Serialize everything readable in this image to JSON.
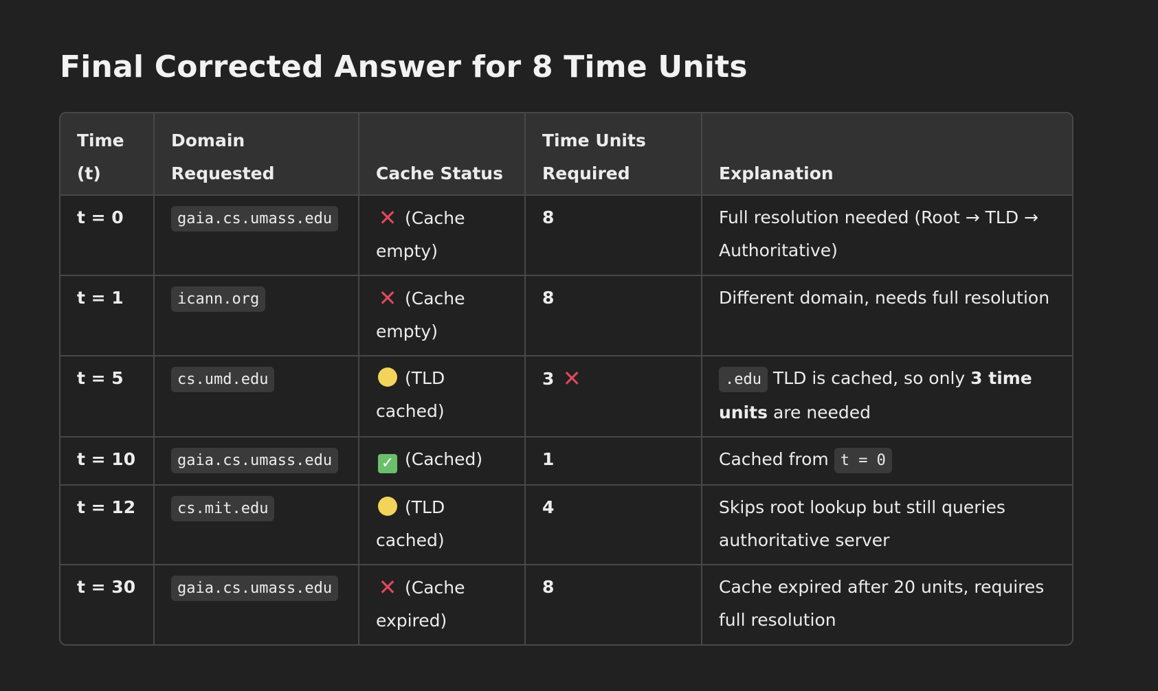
{
  "title": "Final Corrected Answer for 8 Time Units",
  "table": {
    "headers": {
      "time_line1": "Time",
      "time_line2": "(t)",
      "domain": "Domain Requested",
      "cache": "Cache Status",
      "units_line1": "Time Units",
      "units_line2": "Required",
      "explanation": "Explanation"
    },
    "rows": [
      {
        "time": "t = 0",
        "domain": "gaia.cs.umass.edu",
        "cache_icon": "cross-mark-icon",
        "cache_text_line1": "(Cache",
        "cache_text_line2": "empty)",
        "units": "8",
        "explanation_line1": "Full resolution needed (Root → TLD →",
        "explanation_line2": "Authoritative)"
      },
      {
        "time": "t = 1",
        "domain": "icann.org",
        "cache_icon": "cross-mark-icon",
        "cache_text_line1": "(Cache",
        "cache_text_line2": "empty)",
        "units": "8",
        "explanation_line1": "Different domain, needs full resolution"
      },
      {
        "time": "t = 5",
        "domain": "cs.umd.edu",
        "cache_icon": "yellow-circle-icon",
        "cache_text_line1": "(TLD",
        "cache_text_line2": "cached)",
        "units": "3",
        "units_icon": "cross-mark-icon",
        "explanation_code": ".edu",
        "explanation_part1": " TLD is cached, so only ",
        "explanation_bold1": "3 time",
        "explanation_bold2": "units",
        "explanation_part2": " are needed"
      },
      {
        "time": "t = 10",
        "domain": "gaia.cs.umass.edu",
        "cache_icon": "check-mark-icon",
        "cache_text_line1": "(Cached)",
        "units": "1",
        "explanation_line1": "Cached from ",
        "explanation_code": "t = 0"
      },
      {
        "time": "t = 12",
        "domain": "cs.mit.edu",
        "cache_icon": "yellow-circle-icon",
        "cache_text_line1": "(TLD",
        "cache_text_line2": "cached)",
        "units": "4",
        "explanation_line1": "Skips root lookup but still queries",
        "explanation_line2": "authoritative server"
      },
      {
        "time": "t = 30",
        "domain": "gaia.cs.umass.edu",
        "cache_icon": "cross-mark-icon",
        "cache_text_line1": "(Cache",
        "cache_text_line2": "expired)",
        "units": "8",
        "explanation_line1": "Cache expired after 20 units, requires",
        "explanation_line2": "full resolution"
      }
    ]
  },
  "colors": {
    "background": "#212121",
    "header_background": "#323232",
    "border": "#484848",
    "cross_mark": "#e0485f",
    "yellow_circle": "#f3d35a",
    "check_mark": "#6bbf6b"
  }
}
